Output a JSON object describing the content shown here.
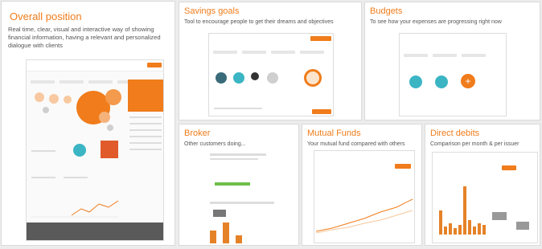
{
  "cards": {
    "overall": {
      "title": "Overall position",
      "description": "Real time, clear, visual and interactive way of showing financial information, having a relevant and personalized dialogue with clients"
    },
    "savings": {
      "title": "Savings goals",
      "subtitle": "Tool to encourage people to get their dreams and objectives"
    },
    "budgets": {
      "title": "Budgets",
      "subtitle": "To see how your expenses are progressing right now"
    },
    "broker": {
      "title": "Broker",
      "subtitle": "Other customers doing..."
    },
    "funds": {
      "title": "Mutual Funds",
      "subtitle": "Your mutual fund compared with others"
    },
    "debits": {
      "title": "Direct debits",
      "subtitle": "Comparison per month & per issuer"
    }
  },
  "colors": {
    "accent": "#f07c1b",
    "teal": "#3bb5c4",
    "green": "#6fbf4a"
  }
}
